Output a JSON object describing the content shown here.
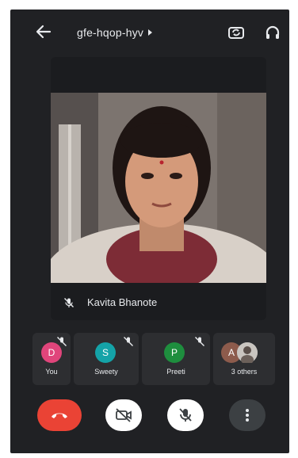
{
  "header": {
    "meeting_code": "gfe-hqop-hyv",
    "icons": {
      "back": "arrow-left-icon",
      "switch_camera": "switch-camera-icon",
      "audio": "headphones-icon"
    }
  },
  "main_tile": {
    "participant_name": "Kavita Bhanote",
    "mic_state": "muted",
    "icons": {
      "mic": "mic-off-icon"
    }
  },
  "participants": [
    {
      "initial": "D",
      "label": "You",
      "avatar_color": "#e0457b",
      "muted": true
    },
    {
      "initial": "S",
      "label": "Sweety",
      "avatar_color": "#14a3a8",
      "muted": true
    },
    {
      "initial": "P",
      "label": "Preeti",
      "avatar_color": "#1e8e3e",
      "muted": true
    },
    {
      "initial": "A",
      "label": "3 others",
      "avatar_color": "#8d5b4c",
      "muted": false
    }
  ],
  "controls": {
    "end_call": {
      "icon": "phone-hangup-icon",
      "color": "#ea4335"
    },
    "camera": {
      "icon": "video-off-icon",
      "state": "off"
    },
    "microphone": {
      "icon": "mic-off-icon",
      "state": "off"
    },
    "more": {
      "icon": "more-vertical-icon"
    }
  },
  "colors": {
    "background": "#202124",
    "tile": "#2d2e31",
    "text": "#e8eaed"
  }
}
